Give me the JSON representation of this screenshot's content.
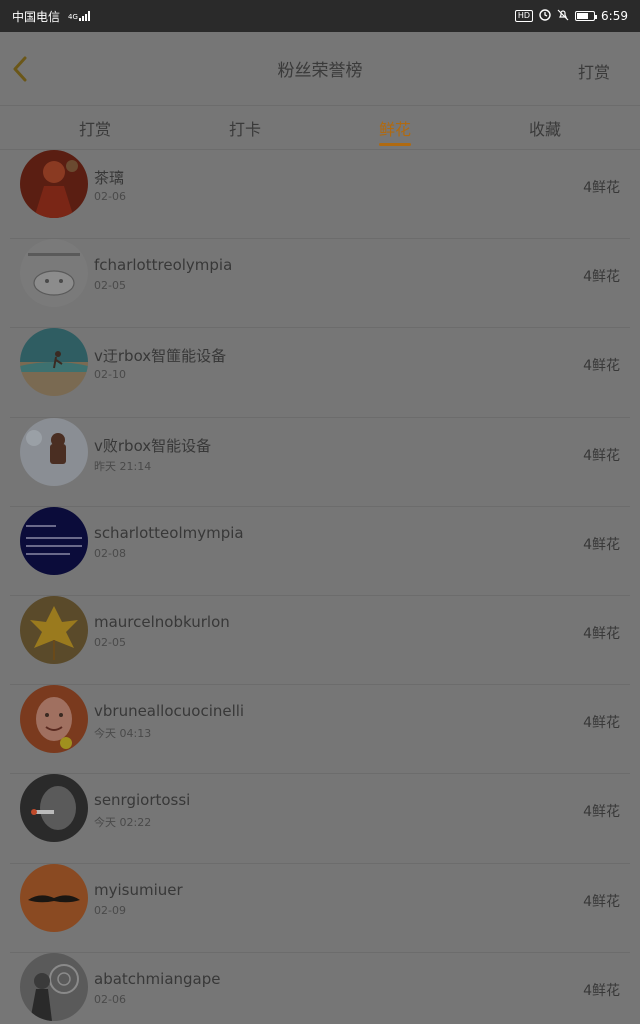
{
  "status_bar": {
    "carrier": "中国电信",
    "network": "4G",
    "hd": "HD",
    "time": "6:59",
    "battery_level": 0.7
  },
  "header": {
    "title": "粉丝荣誉榜",
    "action": "打赏"
  },
  "tabs": [
    {
      "label": "打赏",
      "active": false
    },
    {
      "label": "打卡",
      "active": false
    },
    {
      "label": "鲜花",
      "active": true
    },
    {
      "label": "收藏",
      "active": false
    }
  ],
  "fans": [
    {
      "name": "茶璃",
      "date": "02-06",
      "count": "4鲜花"
    },
    {
      "name": "fcharlottreolympia",
      "date": "02-05",
      "count": "4鲜花"
    },
    {
      "name": "v迂rbox智篚能设备",
      "date": "02-10",
      "count": "4鲜花"
    },
    {
      "name": "v败rbox智能设备",
      "date": "昨天 21:14",
      "count": "4鲜花"
    },
    {
      "name": "scharlotteolmympia",
      "date": "02-08",
      "count": "4鲜花"
    },
    {
      "name": "maurcelnobkurlon",
      "date": "02-05",
      "count": "4鲜花"
    },
    {
      "name": "vbruneallocuocinelli",
      "date": "今天 04:13",
      "count": "4鲜花"
    },
    {
      "name": "senrgiortossi",
      "date": "今天 02:22",
      "count": "4鲜花"
    },
    {
      "name": "myisumiuer",
      "date": "02-09",
      "count": "4鲜花"
    },
    {
      "name": "abatchmiangape",
      "date": "02-06",
      "count": "4鲜花"
    }
  ],
  "colors": {
    "accent": "#b06a10",
    "overlay_bg": "#767676",
    "status_bar": "#2a2a2a"
  }
}
